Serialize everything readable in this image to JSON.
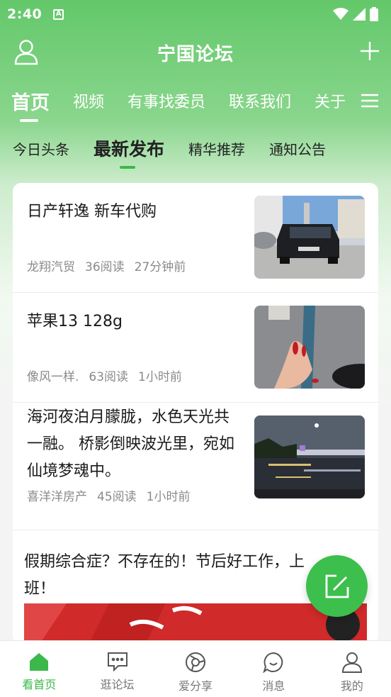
{
  "status_bar": {
    "time": "2:40",
    "notification": "A"
  },
  "header": {
    "title": "宁国论坛"
  },
  "main_tabs": [
    {
      "label": "首页"
    },
    {
      "label": "视频"
    },
    {
      "label": "有事找委员"
    },
    {
      "label": "联系我们"
    },
    {
      "label": "关于"
    }
  ],
  "sub_tabs": [
    {
      "label": "今日头条"
    },
    {
      "label": "最新发布"
    },
    {
      "label": "精华推荐"
    },
    {
      "label": "通知公告"
    }
  ],
  "posts": [
    {
      "title": "日产轩逸 新车代购",
      "author": "龙翔汽贸",
      "reads": "36阅读",
      "time": "27分钟前",
      "thumb": "car-photo"
    },
    {
      "title": "苹果13 128g",
      "author": "像风一样.",
      "reads": "63阅读",
      "time": "1小时前",
      "thumb": "phone-photo"
    },
    {
      "title": "海河夜泊月朦胧，水色天光共一融。 桥影倒映波光里，宛如仙境梦魂中。",
      "author": "喜洋洋房产",
      "reads": "45阅读",
      "time": "1小时前",
      "thumb": "night-river-photo"
    },
    {
      "title": "假期综合症？不存在的！节后好工作，上班！",
      "thumb": "red-banner"
    }
  ],
  "bottom_nav": [
    {
      "label": "看首页",
      "icon": "home-icon",
      "active": true
    },
    {
      "label": "逛论坛",
      "icon": "chat-icon",
      "active": false
    },
    {
      "label": "爱分享",
      "icon": "share-icon",
      "active": false
    },
    {
      "label": "消息",
      "icon": "message-icon",
      "active": false
    },
    {
      "label": "我的",
      "icon": "profile-icon",
      "active": false
    }
  ],
  "colors": {
    "brand": "#3cb84a",
    "header_green": "#63c86a"
  }
}
